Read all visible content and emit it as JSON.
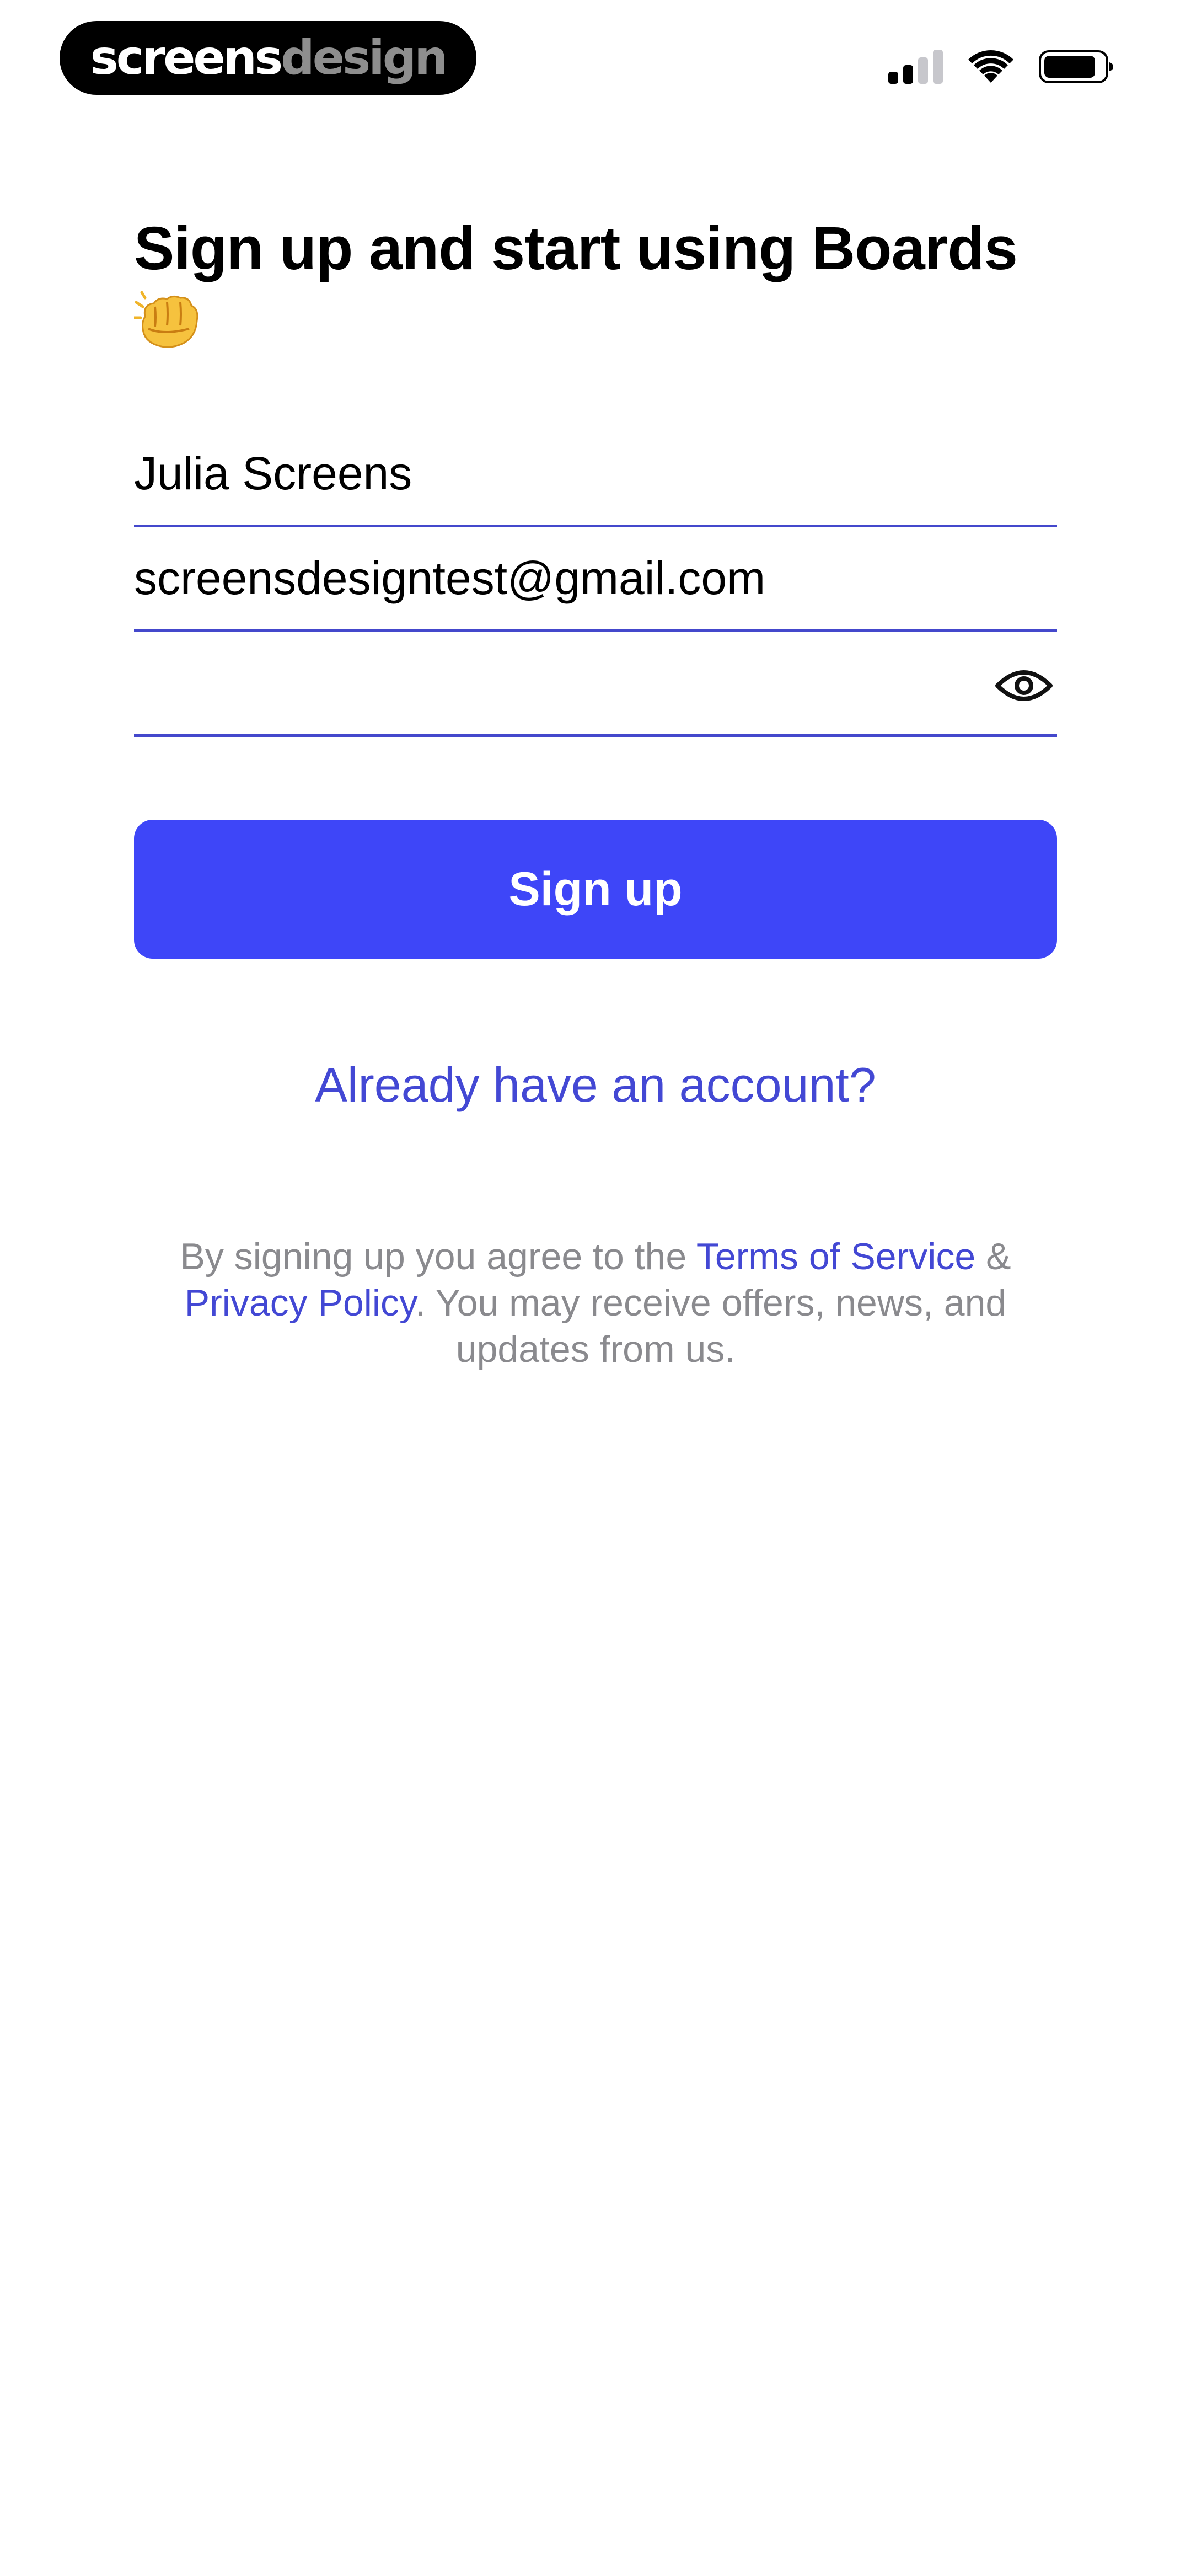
{
  "status_bar": {
    "brand": {
      "part1": "screens",
      "part2": "design"
    },
    "icons": [
      "cellular-signal-icon",
      "wifi-icon",
      "battery-icon"
    ]
  },
  "header": {
    "title": "Sign up and start using Boards",
    "emoji": "oncoming-fist-emoji"
  },
  "form": {
    "name_value": "Julia Screens",
    "email_value": "screensdesigntest@gmail.com",
    "password_value": "",
    "password_toggle_icon": "eye-icon",
    "signup_label": "Sign up"
  },
  "login_link": "Already have an account?",
  "legal": {
    "prefix": "By signing up you agree to the ",
    "terms": "Terms of Service",
    "amp": " & ",
    "privacy": "Privacy Policy",
    "suffix": ". You may receive offers, news, and updates from us."
  },
  "colors": {
    "accent": "#3e46f8",
    "link": "#4348d4",
    "underline": "#4448cc",
    "muted_text": "#8a8a8e"
  }
}
